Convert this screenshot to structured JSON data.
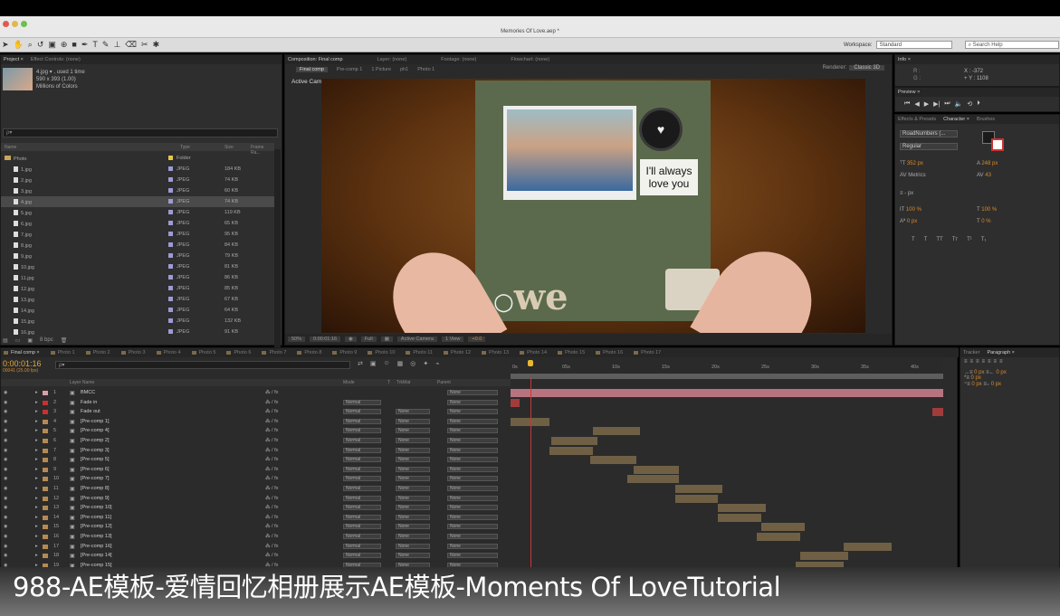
{
  "window": {
    "title": "Memories Of Love.aep *"
  },
  "toolbar": {
    "workspace_label": "Workspace:",
    "workspace_value": "Standard",
    "search_placeholder": "Search Help"
  },
  "project": {
    "tab_label": "Project ×",
    "effect_controls": "Effect Controls: (none)",
    "selected_name": "4.jpg ▾ , used 1 time",
    "dims": "590 x 393 (1.00)",
    "colors": "Millions of Colors",
    "search_placeholder": "ρ▾",
    "columns": {
      "name": "Name",
      "type": "Type",
      "size": "Size",
      "frame_rate": "Frame Ra..."
    },
    "rows": [
      {
        "name": "Photo",
        "type": "Folder",
        "size": "",
        "folder": true,
        "color": "#e6c84a"
      },
      {
        "name": "1.jpg",
        "type": "JPEG",
        "size": "184 KB",
        "color": "#9b9bd6"
      },
      {
        "name": "2.jpg",
        "type": "JPEG",
        "size": "74 KB",
        "color": "#9b9bd6"
      },
      {
        "name": "3.jpg",
        "type": "JPEG",
        "size": "60 KB",
        "color": "#9b9bd6"
      },
      {
        "name": "4.jpg",
        "type": "JPEG",
        "size": "74 KB",
        "color": "#9b9bd6",
        "selected": true
      },
      {
        "name": "5.jpg",
        "type": "JPEG",
        "size": "119 KB",
        "color": "#9b9bd6"
      },
      {
        "name": "6.jpg",
        "type": "JPEG",
        "size": "65 KB",
        "color": "#9b9bd6"
      },
      {
        "name": "7.jpg",
        "type": "JPEG",
        "size": "95 KB",
        "color": "#9b9bd6"
      },
      {
        "name": "8.jpg",
        "type": "JPEG",
        "size": "84 KB",
        "color": "#9b9bd6"
      },
      {
        "name": "9.jpg",
        "type": "JPEG",
        "size": "79 KB",
        "color": "#9b9bd6"
      },
      {
        "name": "10.jpg",
        "type": "JPEG",
        "size": "81 KB",
        "color": "#9b9bd6"
      },
      {
        "name": "11.jpg",
        "type": "JPEG",
        "size": "86 KB",
        "color": "#9b9bd6"
      },
      {
        "name": "12.jpg",
        "type": "JPEG",
        "size": "85 KB",
        "color": "#9b9bd6"
      },
      {
        "name": "13.jpg",
        "type": "JPEG",
        "size": "67 KB",
        "color": "#9b9bd6"
      },
      {
        "name": "14.jpg",
        "type": "JPEG",
        "size": "64 KB",
        "color": "#9b9bd6"
      },
      {
        "name": "15.jpg",
        "type": "JPEG",
        "size": "132 KB",
        "color": "#9b9bd6"
      },
      {
        "name": "16.jpg",
        "type": "JPEG",
        "size": "91 KB",
        "color": "#9b9bd6"
      }
    ],
    "bpc": "8 bpc"
  },
  "composition": {
    "tabs": [
      "Composition: Final comp",
      "Layer: (none)",
      "Footage: (none)",
      "Flowchart: (none)"
    ],
    "subtabs": [
      "Final comp",
      "Pre-comp 1",
      "1 Picture",
      "ph1",
      "Photo 1"
    ],
    "renderer_label": "Renderer:",
    "renderer_value": "Classic 3D",
    "view_label": "Active Camera",
    "note_line1": "I'll always",
    "note_line2": "love you",
    "cover_text": "we",
    "footer": {
      "zoom": "50%",
      "time": "0:00:01:16",
      "resolution": "Full",
      "camera": "Active Camera",
      "views": "1 View",
      "exposure": "+0.0"
    }
  },
  "info": {
    "tab": "Info ×",
    "r_label": "R :",
    "g_label": "G :",
    "x": "X : -372",
    "y": "+ Y : 1108"
  },
  "preview": {
    "tab": "Preview ×"
  },
  "character": {
    "tabs": [
      "Effects & Presets",
      "Character ×",
      "Brushes"
    ],
    "font": "RoadNumbers (...",
    "style": "Regular",
    "size": "352 px",
    "leading": "248 px",
    "kerning": "Metrics",
    "tracking": "43",
    "stroke": "- px",
    "vscale": "100 %",
    "hscale": "100 %",
    "baseline": "0 px",
    "tsume": "0 %",
    "styles": [
      "T",
      "T",
      "TT",
      "Tт",
      "T¹",
      "T₁"
    ]
  },
  "paragraph": {
    "tabs": [
      "Tracker",
      "Paragraph ×"
    ],
    "indent_left": "0 px",
    "indent_right": "0 px",
    "indent_first": "0 px",
    "space_before": "0 px",
    "space_after": "0 px"
  },
  "timeline": {
    "tabs": [
      "Final comp ×",
      "Photo 1",
      "Photo 2",
      "Photo 3",
      "Photo 4",
      "Photo 5",
      "Photo 6",
      "Photo 7",
      "Photo 8",
      "Photo 9",
      "Photo 10",
      "Photo 11",
      "Photo 12",
      "Photo 13",
      "Photo 14",
      "Photo 15",
      "Photo 16",
      "Photo 17"
    ],
    "timecode": "0:00:01:16",
    "fps": "00041 (25.00 fps)",
    "search_placeholder": "ρ▾",
    "columns": {
      "layer_name": "Layer Name",
      "mode": "Mode",
      "t": "T",
      "trkmat": "TrkMat",
      "parent": "Parent"
    },
    "ruler": [
      "0s",
      "05s",
      "10s",
      "15s",
      "20s",
      "25s",
      "30s",
      "35s",
      "40s"
    ],
    "current_time_fraction": 0.047,
    "layers": [
      {
        "num": "1",
        "name": "BMCC",
        "color": "#d9a0a8",
        "mode": "",
        "trkmat": "",
        "parent": "None",
        "bar": [
          0,
          1
        ],
        "bar_style": "pink"
      },
      {
        "num": "2",
        "name": "Fade in",
        "color": "#c93030",
        "mode": "Normal",
        "trkmat": "",
        "parent": "None",
        "bar": [
          0,
          0.02
        ],
        "bar_style": "red"
      },
      {
        "num": "3",
        "name": "Fade out",
        "color": "#c93030",
        "mode": "Normal",
        "trkmat": "None",
        "parent": "None",
        "bar": [
          0.975,
          1
        ],
        "bar_style": "red"
      },
      {
        "num": "4",
        "name": "[Pre-comp 1]",
        "color": "#b58a52",
        "mode": "Normal",
        "trkmat": "None",
        "parent": "None",
        "bar": [
          0,
          0.09
        ]
      },
      {
        "num": "5",
        "name": "[Pre-comp 4]",
        "color": "#b58a52",
        "mode": "Normal",
        "trkmat": "None",
        "parent": "None",
        "bar": [
          0.19,
          0.3
        ]
      },
      {
        "num": "6",
        "name": "[Pre-comp 2]",
        "color": "#b58a52",
        "mode": "Normal",
        "trkmat": "None",
        "parent": "None",
        "bar": [
          0.095,
          0.2
        ]
      },
      {
        "num": "7",
        "name": "[Pre-comp 3]",
        "color": "#b58a52",
        "mode": "Normal",
        "trkmat": "None",
        "parent": "None",
        "bar": [
          0.09,
          0.19
        ]
      },
      {
        "num": "8",
        "name": "[Pre-comp 5]",
        "color": "#b58a52",
        "mode": "Normal",
        "trkmat": "None",
        "parent": "None",
        "bar": [
          0.185,
          0.29
        ]
      },
      {
        "num": "9",
        "name": "[Pre-comp 6]",
        "color": "#b58a52",
        "mode": "Normal",
        "trkmat": "None",
        "parent": "None",
        "bar": [
          0.285,
          0.39
        ]
      },
      {
        "num": "10",
        "name": "[Pre-comp 7]",
        "color": "#b58a52",
        "mode": "Normal",
        "trkmat": "None",
        "parent": "None",
        "bar": [
          0.27,
          0.39
        ]
      },
      {
        "num": "11",
        "name": "[Pre-comp 8]",
        "color": "#b58a52",
        "mode": "Normal",
        "trkmat": "None",
        "parent": "None",
        "bar": [
          0.38,
          0.49
        ]
      },
      {
        "num": "12",
        "name": "[Pre-comp 9]",
        "color": "#b58a52",
        "mode": "Normal",
        "trkmat": "None",
        "parent": "None",
        "bar": [
          0.38,
          0.48
        ]
      },
      {
        "num": "13",
        "name": "[Pre-comp 10]",
        "color": "#b58a52",
        "mode": "Normal",
        "trkmat": "None",
        "parent": "None",
        "bar": [
          0.48,
          0.59
        ]
      },
      {
        "num": "14",
        "name": "[Pre-comp 11]",
        "color": "#b58a52",
        "mode": "Normal",
        "trkmat": "None",
        "parent": "None",
        "bar": [
          0.48,
          0.58
        ]
      },
      {
        "num": "15",
        "name": "[Pre-comp 12]",
        "color": "#b58a52",
        "mode": "Normal",
        "trkmat": "None",
        "parent": "None",
        "bar": [
          0.58,
          0.68
        ]
      },
      {
        "num": "16",
        "name": "[Pre-comp 13]",
        "color": "#b58a52",
        "mode": "Normal",
        "trkmat": "None",
        "parent": "None",
        "bar": [
          0.57,
          0.67
        ]
      },
      {
        "num": "17",
        "name": "[Pre-comp 16]",
        "color": "#b58a52",
        "mode": "Normal",
        "trkmat": "None",
        "parent": "None",
        "bar": [
          0.77,
          0.88
        ]
      },
      {
        "num": "18",
        "name": "[Pre-comp 14]",
        "color": "#b58a52",
        "mode": "Normal",
        "trkmat": "None",
        "parent": "None",
        "bar": [
          0.67,
          0.78
        ]
      },
      {
        "num": "19",
        "name": "[Pre-comp 15]",
        "color": "#b58a52",
        "mode": "Normal",
        "trkmat": "None",
        "parent": "None",
        "bar": [
          0.66,
          0.77
        ]
      }
    ]
  },
  "caption": "988-AE模板-爱情回忆相册展示AE模板-Moments Of LoveTutorial"
}
